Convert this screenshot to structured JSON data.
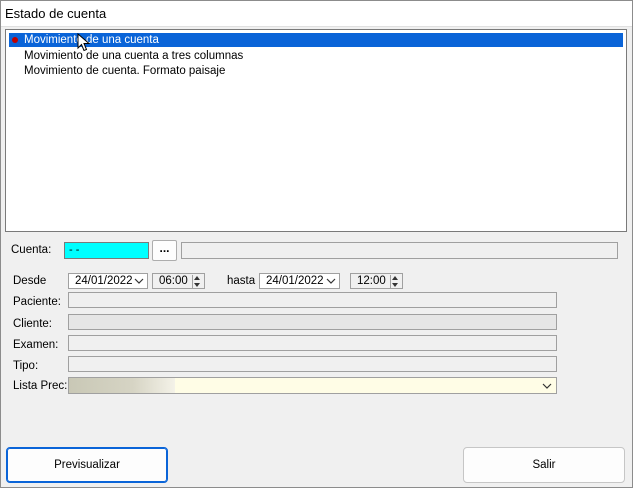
{
  "window": {
    "title": "Estado de cuenta"
  },
  "report_list": {
    "items": [
      {
        "label": "Movimiento de una cuenta",
        "selected": true
      },
      {
        "label": "Movimiento de una cuenta a tres columnas",
        "selected": false
      },
      {
        "label": "Movimiento de cuenta. Formato paisaje",
        "selected": false
      }
    ]
  },
  "cuenta": {
    "label": "Cuenta:",
    "value": "- -",
    "lookup_label": "...",
    "description": ""
  },
  "range": {
    "desde_label": "Desde",
    "desde_date": "24/01/2022",
    "desde_time": "06:00",
    "hasta_label": "hasta",
    "hasta_date": "24/01/2022",
    "hasta_time": "12:00"
  },
  "filters": {
    "paciente_label": "Paciente:",
    "paciente_value": "",
    "cliente_label": "Cliente:",
    "cliente_value": "",
    "examen_label": "Examen:",
    "examen_value": "",
    "tipo_label": "Tipo:",
    "tipo_value": "",
    "lista_prec_label": "Lista Prec:",
    "lista_prec_value": ""
  },
  "actions": {
    "preview_label": "Previsualizar",
    "exit_label": "Salir"
  },
  "colors": {
    "selection": "#0a64d8",
    "cuenta_field": "#00ffff",
    "combo_bg": "#fffde6",
    "bullet": "#c00000"
  }
}
